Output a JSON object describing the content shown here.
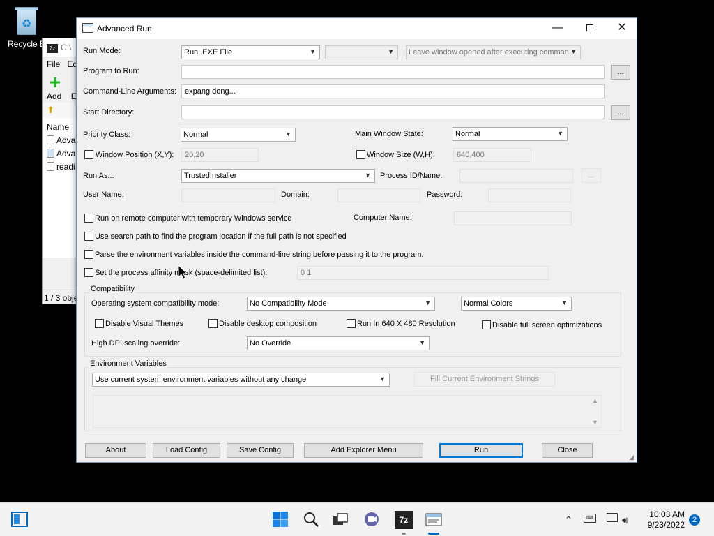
{
  "desktop": {
    "recycle_bin_label": "Recycle B"
  },
  "bg_window": {
    "title": "C:\\",
    "badge": "7z",
    "menu": [
      "File",
      "Ed"
    ],
    "add_label": "Add",
    "add_extra": "E",
    "name_header": "Name",
    "files": [
      "Adva",
      "Adva",
      "readi"
    ],
    "status": "1 / 3 obje"
  },
  "dialog": {
    "title": "Advanced Run",
    "run_mode": {
      "label": "Run Mode:",
      "value": "Run .EXE File",
      "second_value": "",
      "leave_open": "Leave window opened after executing comman"
    },
    "program": {
      "label": "Program to Run:",
      "value": "",
      "browse": "..."
    },
    "args": {
      "label": "Command-Line Arguments:",
      "value": "expang dong..."
    },
    "start_dir": {
      "label": "Start Directory:",
      "value": "",
      "browse": "..."
    },
    "priority": {
      "label": "Priority Class:",
      "value": "Normal"
    },
    "main_window_state": {
      "label": "Main Window State:",
      "value": "Normal"
    },
    "window_position": {
      "label": "Window Position (X,Y):",
      "value": "20,20"
    },
    "window_size": {
      "label": "Window Size (W,H):",
      "value": "640,400"
    },
    "run_as": {
      "label": "Run As...",
      "value": "TrustedInstaller"
    },
    "process_id": {
      "label": "Process ID/Name:",
      "value": "",
      "browse": "..."
    },
    "user_name": {
      "label": "User Name:",
      "value": ""
    },
    "domain": {
      "label": "Domain:",
      "value": ""
    },
    "password": {
      "label": "Password:",
      "value": ""
    },
    "remote": {
      "label": "Run on remote computer with temporary Windows service"
    },
    "computer_name": {
      "label": "Computer Name:",
      "value": ""
    },
    "search_path": {
      "label": "Use search path to find the program location if the full path is not specified"
    },
    "parse_env": {
      "label": "Parse the environment variables inside the command-line string before passing it to the program."
    },
    "affinity": {
      "label": "Set the process affinity mask (space-delimited list):",
      "value": "0 1"
    },
    "compatibility": {
      "legend": "Compatibility",
      "os_mode_label": "Operating system compatibility mode:",
      "os_mode_value": "No Compatibility Mode",
      "colors_value": "Normal Colors",
      "disable_themes": "Disable Visual Themes",
      "disable_composition": "Disable desktop composition",
      "run_640": "Run In 640 X 480 Resolution",
      "disable_fullscreen": "Disable full screen optimizations",
      "dpi_label": "High DPI scaling override:",
      "dpi_value": "No Override"
    },
    "env": {
      "legend": "Environment Variables",
      "mode_value": "Use current system environment variables without any change",
      "fill_button": "Fill Current Environment Strings"
    },
    "buttons": {
      "about": "About",
      "load": "Load Config",
      "save": "Save Config",
      "explorer": "Add Explorer Menu",
      "run": "Run",
      "close": "Close"
    }
  },
  "taskbar": {
    "time": "10:03 AM",
    "date": "9/23/2022",
    "notifications": "2",
    "zip_badge": "7z"
  }
}
